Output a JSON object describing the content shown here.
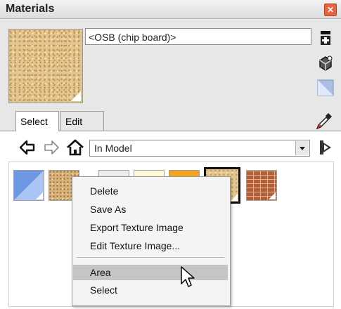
{
  "window": {
    "title": "Materials",
    "close_glyph": "✕"
  },
  "material": {
    "name": "<OSB (chip board)>"
  },
  "tabs": [
    {
      "label": "Select"
    },
    {
      "label": "Edit"
    }
  ],
  "nav": {
    "collection": "In Model"
  },
  "swatches": [
    {
      "name": "blue-material-swatch"
    },
    {
      "name": "chipboard-swatch"
    },
    {
      "name": "light-gray-swatch"
    },
    {
      "name": "cream-swatch"
    },
    {
      "name": "orange-swatch"
    },
    {
      "name": "osb-swatch",
      "selected": true
    },
    {
      "name": "brick-swatch"
    }
  ],
  "context_menu": {
    "items": [
      {
        "label": "Delete"
      },
      {
        "label": "Save As"
      },
      {
        "label": "Export Texture Image"
      },
      {
        "label": "Edit Texture Image..."
      },
      {
        "label": "Area",
        "highlighted": true
      },
      {
        "label": "Select"
      }
    ]
  },
  "icons": {
    "side": [
      "display-secondary-pane-icon",
      "create-material-icon",
      "default-material-icon",
      "sample-paint-icon"
    ],
    "nav": [
      "back-arrow-icon",
      "forward-arrow-icon",
      "home-icon",
      "details-arrow-icon"
    ]
  },
  "colors": {
    "panel_bg": "#e7e7e7",
    "menu_highlight": "#c5c5c5",
    "selected_border": "#111111"
  }
}
